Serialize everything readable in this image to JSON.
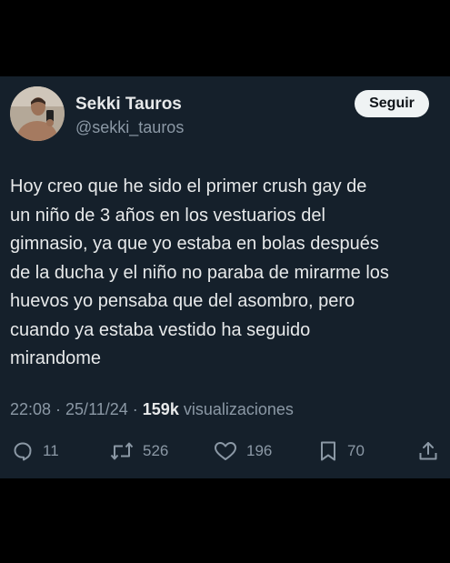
{
  "author": {
    "name": "Sekki Tauros",
    "handle": "@sekki_tauros"
  },
  "follow_button": {
    "label": "Seguir"
  },
  "tweet": {
    "lines": [
      "Hoy creo que he sido el primer crush gay de",
      "un niño de 3 años en los vestuarios del",
      "gimnasio, ya que yo estaba en bolas después",
      "de la ducha y el niño no paraba de mirarme los",
      "huevos yo pensaba que del asombro, pero",
      "cuando ya estaba vestido ha seguido",
      "mirandome"
    ]
  },
  "meta": {
    "timestamp": "22:08 · 25/11/24 · ",
    "views_count": "159k",
    "views_label": " visualizaciones"
  },
  "actions": {
    "replies": "11",
    "retweets": "526",
    "likes": "196",
    "bookmarks": "70"
  },
  "colors": {
    "background": "#000000",
    "card": "#15202b",
    "text": "#e7e9ea",
    "secondary": "#8b98a5",
    "follow_bg": "#eff3f4"
  },
  "icons": {
    "reply": "reply-icon",
    "retweet": "retweet-icon",
    "like": "heart-icon",
    "bookmark": "bookmark-icon",
    "share": "share-icon"
  }
}
